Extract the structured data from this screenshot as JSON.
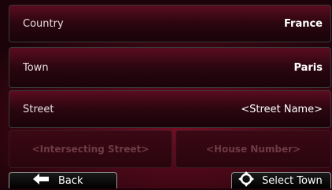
{
  "fields": {
    "country": {
      "label": "Country",
      "value": "France"
    },
    "town": {
      "label": "Town",
      "value": "Paris"
    },
    "street": {
      "label": "Street",
      "value": "<Street Name>"
    }
  },
  "disabled_fields": {
    "intersecting_street": "<Intersecting Street>",
    "house_number": "<House Number>"
  },
  "buttons": {
    "back_label": "Back",
    "select_town_label": "Select Town"
  },
  "icons": {
    "back": "left-arrow-icon",
    "select_town": "crosshair-target-icon"
  },
  "colors": {
    "accent_background": "#4a0818",
    "disabled_text": "#6e3a46"
  }
}
